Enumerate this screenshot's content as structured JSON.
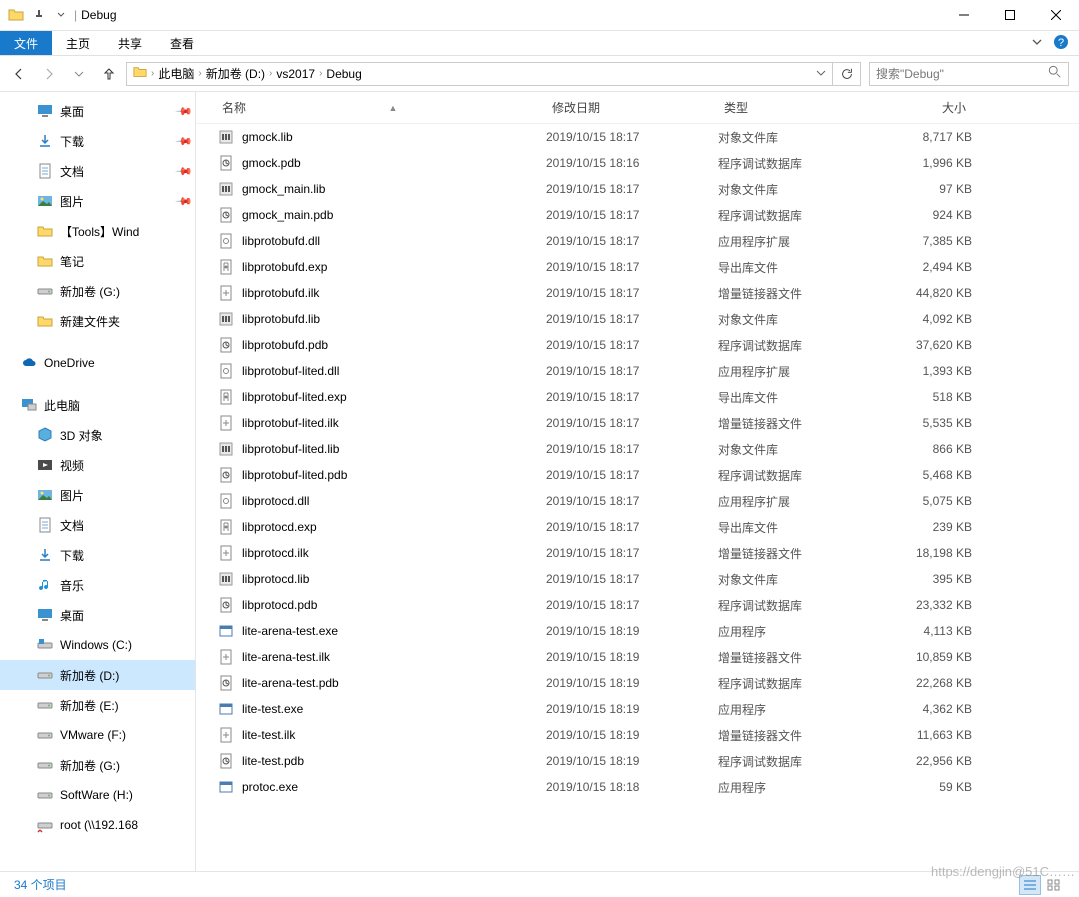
{
  "window": {
    "title": "Debug",
    "buttons": {
      "min": "—",
      "max": "☐",
      "close": "✕"
    }
  },
  "ribbon": {
    "file": "文件",
    "tabs": [
      "主页",
      "共享",
      "查看"
    ]
  },
  "address": {
    "crumbs": [
      "此电脑",
      "新加卷 (D:)",
      "vs2017",
      "Debug"
    ],
    "search_placeholder": "搜索\"Debug\""
  },
  "columns": {
    "name": "名称",
    "date": "修改日期",
    "type": "类型",
    "size": "大小"
  },
  "sidebar": {
    "quick": [
      {
        "label": "桌面",
        "icon": "monitor",
        "pin": true
      },
      {
        "label": "下载",
        "icon": "download",
        "pin": true
      },
      {
        "label": "文档",
        "icon": "doc",
        "pin": true
      },
      {
        "label": "图片",
        "icon": "pic",
        "pin": true
      },
      {
        "label": "【Tools】Wind",
        "icon": "folder",
        "pin": false
      },
      {
        "label": "笔记",
        "icon": "folder",
        "pin": false
      },
      {
        "label": "新加卷 (G:)",
        "icon": "drive",
        "pin": false
      },
      {
        "label": "新建文件夹",
        "icon": "folder",
        "pin": false
      }
    ],
    "onedrive": {
      "label": "OneDrive",
      "icon": "cloud"
    },
    "thispc": {
      "label": "此电脑",
      "icon": "pc"
    },
    "pc_items": [
      {
        "label": "3D 对象",
        "icon": "3d"
      },
      {
        "label": "视频",
        "icon": "video"
      },
      {
        "label": "图片",
        "icon": "pic"
      },
      {
        "label": "文档",
        "icon": "doc"
      },
      {
        "label": "下载",
        "icon": "download"
      },
      {
        "label": "音乐",
        "icon": "music"
      },
      {
        "label": "桌面",
        "icon": "monitor"
      },
      {
        "label": "Windows (C:)",
        "icon": "drivewin"
      },
      {
        "label": "新加卷 (D:)",
        "icon": "drive",
        "selected": true
      },
      {
        "label": "新加卷 (E:)",
        "icon": "drive"
      },
      {
        "label": "VMware (F:)",
        "icon": "drive"
      },
      {
        "label": "新加卷 (G:)",
        "icon": "drive"
      },
      {
        "label": "SoftWare (H:)",
        "icon": "drive"
      },
      {
        "label": "root (\\\\192.168",
        "icon": "netdrive"
      }
    ]
  },
  "files": [
    {
      "name": "gmock.lib",
      "date": "2019/10/15 18:17",
      "type": "对象文件库",
      "size": "8,717 KB",
      "icon": "lib"
    },
    {
      "name": "gmock.pdb",
      "date": "2019/10/15 18:16",
      "type": "程序调试数据库",
      "size": "1,996 KB",
      "icon": "pdb"
    },
    {
      "name": "gmock_main.lib",
      "date": "2019/10/15 18:17",
      "type": "对象文件库",
      "size": "97 KB",
      "icon": "lib"
    },
    {
      "name": "gmock_main.pdb",
      "date": "2019/10/15 18:17",
      "type": "程序调试数据库",
      "size": "924 KB",
      "icon": "pdb"
    },
    {
      "name": "libprotobufd.dll",
      "date": "2019/10/15 18:17",
      "type": "应用程序扩展",
      "size": "7,385 KB",
      "icon": "dll"
    },
    {
      "name": "libprotobufd.exp",
      "date": "2019/10/15 18:17",
      "type": "导出库文件",
      "size": "2,494 KB",
      "icon": "exp"
    },
    {
      "name": "libprotobufd.ilk",
      "date": "2019/10/15 18:17",
      "type": "增量链接器文件",
      "size": "44,820 KB",
      "icon": "ilk"
    },
    {
      "name": "libprotobufd.lib",
      "date": "2019/10/15 18:17",
      "type": "对象文件库",
      "size": "4,092 KB",
      "icon": "lib"
    },
    {
      "name": "libprotobufd.pdb",
      "date": "2019/10/15 18:17",
      "type": "程序调试数据库",
      "size": "37,620 KB",
      "icon": "pdb"
    },
    {
      "name": "libprotobuf-lited.dll",
      "date": "2019/10/15 18:17",
      "type": "应用程序扩展",
      "size": "1,393 KB",
      "icon": "dll"
    },
    {
      "name": "libprotobuf-lited.exp",
      "date": "2019/10/15 18:17",
      "type": "导出库文件",
      "size": "518 KB",
      "icon": "exp"
    },
    {
      "name": "libprotobuf-lited.ilk",
      "date": "2019/10/15 18:17",
      "type": "增量链接器文件",
      "size": "5,535 KB",
      "icon": "ilk"
    },
    {
      "name": "libprotobuf-lited.lib",
      "date": "2019/10/15 18:17",
      "type": "对象文件库",
      "size": "866 KB",
      "icon": "lib"
    },
    {
      "name": "libprotobuf-lited.pdb",
      "date": "2019/10/15 18:17",
      "type": "程序调试数据库",
      "size": "5,468 KB",
      "icon": "pdb"
    },
    {
      "name": "libprotocd.dll",
      "date": "2019/10/15 18:17",
      "type": "应用程序扩展",
      "size": "5,075 KB",
      "icon": "dll"
    },
    {
      "name": "libprotocd.exp",
      "date": "2019/10/15 18:17",
      "type": "导出库文件",
      "size": "239 KB",
      "icon": "exp"
    },
    {
      "name": "libprotocd.ilk",
      "date": "2019/10/15 18:17",
      "type": "增量链接器文件",
      "size": "18,198 KB",
      "icon": "ilk"
    },
    {
      "name": "libprotocd.lib",
      "date": "2019/10/15 18:17",
      "type": "对象文件库",
      "size": "395 KB",
      "icon": "lib"
    },
    {
      "name": "libprotocd.pdb",
      "date": "2019/10/15 18:17",
      "type": "程序调试数据库",
      "size": "23,332 KB",
      "icon": "pdb"
    },
    {
      "name": "lite-arena-test.exe",
      "date": "2019/10/15 18:19",
      "type": "应用程序",
      "size": "4,113 KB",
      "icon": "exe"
    },
    {
      "name": "lite-arena-test.ilk",
      "date": "2019/10/15 18:19",
      "type": "增量链接器文件",
      "size": "10,859 KB",
      "icon": "ilk"
    },
    {
      "name": "lite-arena-test.pdb",
      "date": "2019/10/15 18:19",
      "type": "程序调试数据库",
      "size": "22,268 KB",
      "icon": "pdb"
    },
    {
      "name": "lite-test.exe",
      "date": "2019/10/15 18:19",
      "type": "应用程序",
      "size": "4,362 KB",
      "icon": "exe"
    },
    {
      "name": "lite-test.ilk",
      "date": "2019/10/15 18:19",
      "type": "增量链接器文件",
      "size": "11,663 KB",
      "icon": "ilk"
    },
    {
      "name": "lite-test.pdb",
      "date": "2019/10/15 18:19",
      "type": "程序调试数据库",
      "size": "22,956 KB",
      "icon": "pdb"
    },
    {
      "name": "protoc.exe",
      "date": "2019/10/15 18:18",
      "type": "应用程序",
      "size": "59 KB",
      "icon": "exe"
    }
  ],
  "status": {
    "text": "34 个项目"
  },
  "watermark": "https://dengjin@51C……"
}
